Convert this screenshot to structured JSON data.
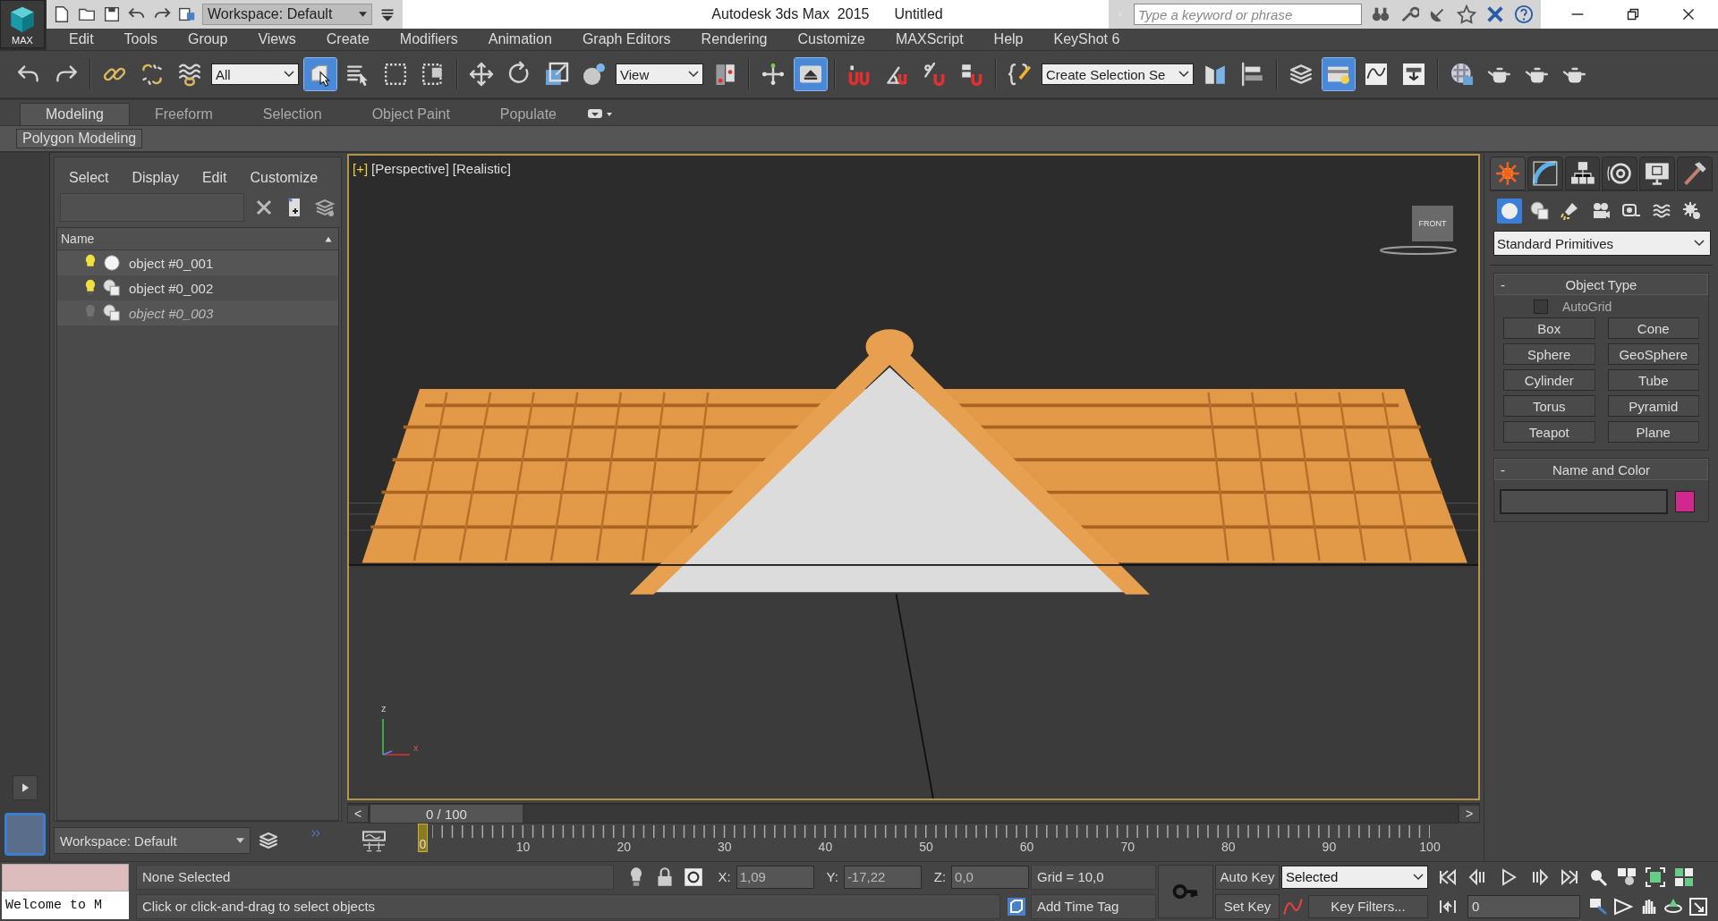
{
  "title_bar": {
    "workspace": "Workspace: Default",
    "app": "Autodesk 3ds Max  2015",
    "document": "Untitled",
    "search": {
      "placeholder": "Type a keyword or phrase"
    }
  },
  "app_button": {
    "label": "MAX"
  },
  "menu": [
    "Edit",
    "Tools",
    "Group",
    "Views",
    "Create",
    "Modifiers",
    "Animation",
    "Graph Editors",
    "Rendering",
    "Customize",
    "MAXScript",
    "Help",
    "KeyShot 6"
  ],
  "main_toolbar": {
    "selection_filter": "All",
    "select_object": {
      "selected": true
    },
    "coord_system": "View",
    "keyboard_override": {
      "selected": true
    },
    "named_selection": "Create Selection Se",
    "scene_explorer_toggle": {
      "selected": true
    }
  },
  "ribbon": {
    "tabs": [
      {
        "label": "Modeling",
        "selected": true
      },
      {
        "label": "Freeform",
        "selected": false
      },
      {
        "label": "Selection",
        "selected": false
      },
      {
        "label": "Object Paint",
        "selected": false
      },
      {
        "label": "Populate",
        "selected": false
      }
    ],
    "panel": "Polygon Modeling"
  },
  "scene_explorer": {
    "menu": [
      "Select",
      "Display",
      "Edit",
      "Customize"
    ],
    "column": "Name",
    "rows": [
      {
        "name": "object #0_001",
        "kind": "sphere",
        "hidden": false
      },
      {
        "name": "object #0_002",
        "kind": "shapes",
        "hidden": false
      },
      {
        "name": "object #0_003",
        "kind": "shapes",
        "hidden": true
      }
    ],
    "workspace": "Workspace: Default"
  },
  "viewport": {
    "labels": [
      "[+]",
      "[Perspective]",
      "[Realistic]"
    ],
    "viewcube": "FRONT",
    "axes": [
      "z",
      "x"
    ]
  },
  "time_slider": {
    "prev": "<",
    "position": "0 / 100",
    "level": 0,
    "next": ">"
  },
  "track_bar": {
    "current_frame": "0",
    "labels": [
      "10",
      "20",
      "30",
      "40",
      "50",
      "60",
      "70",
      "80",
      "90",
      "100"
    ]
  },
  "command_panel": {
    "tabs": [
      {
        "kind": "create",
        "selected": true
      },
      {
        "kind": "modify",
        "selected": false
      },
      {
        "kind": "hierarchy",
        "selected": false
      },
      {
        "kind": "motion",
        "selected": false
      },
      {
        "kind": "display",
        "selected": false
      },
      {
        "kind": "utilities",
        "selected": false
      }
    ],
    "categories": [
      {
        "kind": "geometry",
        "selected": true
      },
      {
        "kind": "shapes",
        "selected": false
      },
      {
        "kind": "lights",
        "selected": false
      },
      {
        "kind": "cameras",
        "selected": false
      },
      {
        "kind": "helpers",
        "selected": false
      },
      {
        "kind": "space_warps",
        "selected": false
      },
      {
        "kind": "systems",
        "selected": false
      }
    ],
    "category_type": "Standard Primitives",
    "object_type": {
      "collapse": "-",
      "title": "Object Type",
      "autogrid": {
        "label": "AutoGrid",
        "checked": false
      },
      "buttons": [
        "Box",
        "Cone",
        "Sphere",
        "GeoSphere",
        "Cylinder",
        "Tube",
        "Torus",
        "Pyramid",
        "Teapot",
        "Plane"
      ]
    },
    "name_and_color": {
      "collapse": "-",
      "title": "Name and Color",
      "color": "#d0288c"
    }
  },
  "status_bar": {
    "listener": "Welcome to M",
    "selection": "None Selected",
    "prompt": "Click or click-and-drag to select objects",
    "x": {
      "label": "X:",
      "value": "1,09"
    },
    "y": {
      "label": "Y:",
      "value": "-17,22"
    },
    "z": {
      "label": "Z:",
      "value": "0,0"
    },
    "grid": "Grid = 10,0",
    "time_tag": "Add Time Tag",
    "auto_key": "Auto Key",
    "set_key": "Set Key",
    "key_mode": "Selected",
    "key_filters": "Key Filters...",
    "frame": "0"
  }
}
